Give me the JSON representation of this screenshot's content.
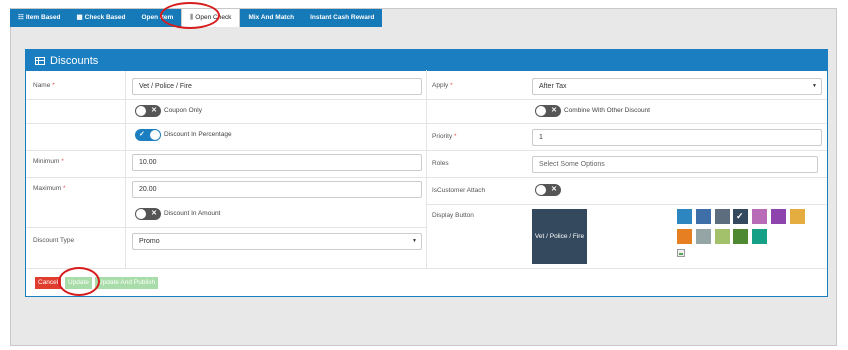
{
  "tabs": [
    {
      "icon": "list-icon",
      "glyph": "☷",
      "label": "Item Based",
      "active": false
    },
    {
      "icon": "grid-icon",
      "glyph": "▦",
      "label": "Check Based",
      "active": false
    },
    {
      "icon": "",
      "glyph": "",
      "label": "Open Item",
      "active": false
    },
    {
      "icon": "bar-chart-icon",
      "glyph": "⫼",
      "label": "Open Check",
      "active": true
    },
    {
      "icon": "",
      "glyph": "",
      "label": "Mix And Match",
      "active": false
    },
    {
      "icon": "",
      "glyph": "",
      "label": "Instant Cash Reward",
      "active": false
    }
  ],
  "panel": {
    "title": "Discounts",
    "icon": "table-icon"
  },
  "left": {
    "name_label": "Name",
    "name_value": "Vet / Police / Fire",
    "coupon_only_label": "Coupon Only",
    "coupon_only": false,
    "discount_percentage_label": "Discount In Percentage",
    "discount_percentage": true,
    "minimum_label": "Minimum",
    "minimum_value": "10.00",
    "maximum_label": "Maximum",
    "maximum_value": "20.00",
    "discount_amount_label": "Discount In Amount",
    "discount_amount": false,
    "discount_type_label": "Discount Type",
    "discount_type_value": "Promo"
  },
  "right": {
    "apply_label": "Apply",
    "apply_value": "After Tax",
    "combine_label": "Combine With Other Discount",
    "combine": false,
    "priority_label": "Priority",
    "priority_value": "1",
    "roles_label": "Roles",
    "roles_placeholder": "Select Some Options",
    "customer_attach_label": "IsCustomer Attach",
    "customer_attach": false,
    "display_button_label": "Display Button",
    "preview_text": "Vet / Police / Fire"
  },
  "required_mark": "*",
  "toggle_mark_off": "✕",
  "toggle_mark_on": "✓",
  "checkmark": "✓",
  "swatches": [
    "#2e86c1",
    "#3f6fa8",
    "#5d6d7e",
    "#34495e",
    "#b86cb8",
    "#8e44ad",
    "#e5ac40",
    "#e67e22",
    "#95a5a6",
    "#a3c16a",
    "#4f8a33",
    "#16a085"
  ],
  "selected_swatch_index": 3,
  "buttons": {
    "cancel": "Cancel",
    "update": "Update",
    "publish": "Update And Publish"
  },
  "colors": {
    "primary": "#1a7ec1",
    "danger": "#e03d2f",
    "success_light": "#a8dca8",
    "annotation": "#d61c1c"
  }
}
